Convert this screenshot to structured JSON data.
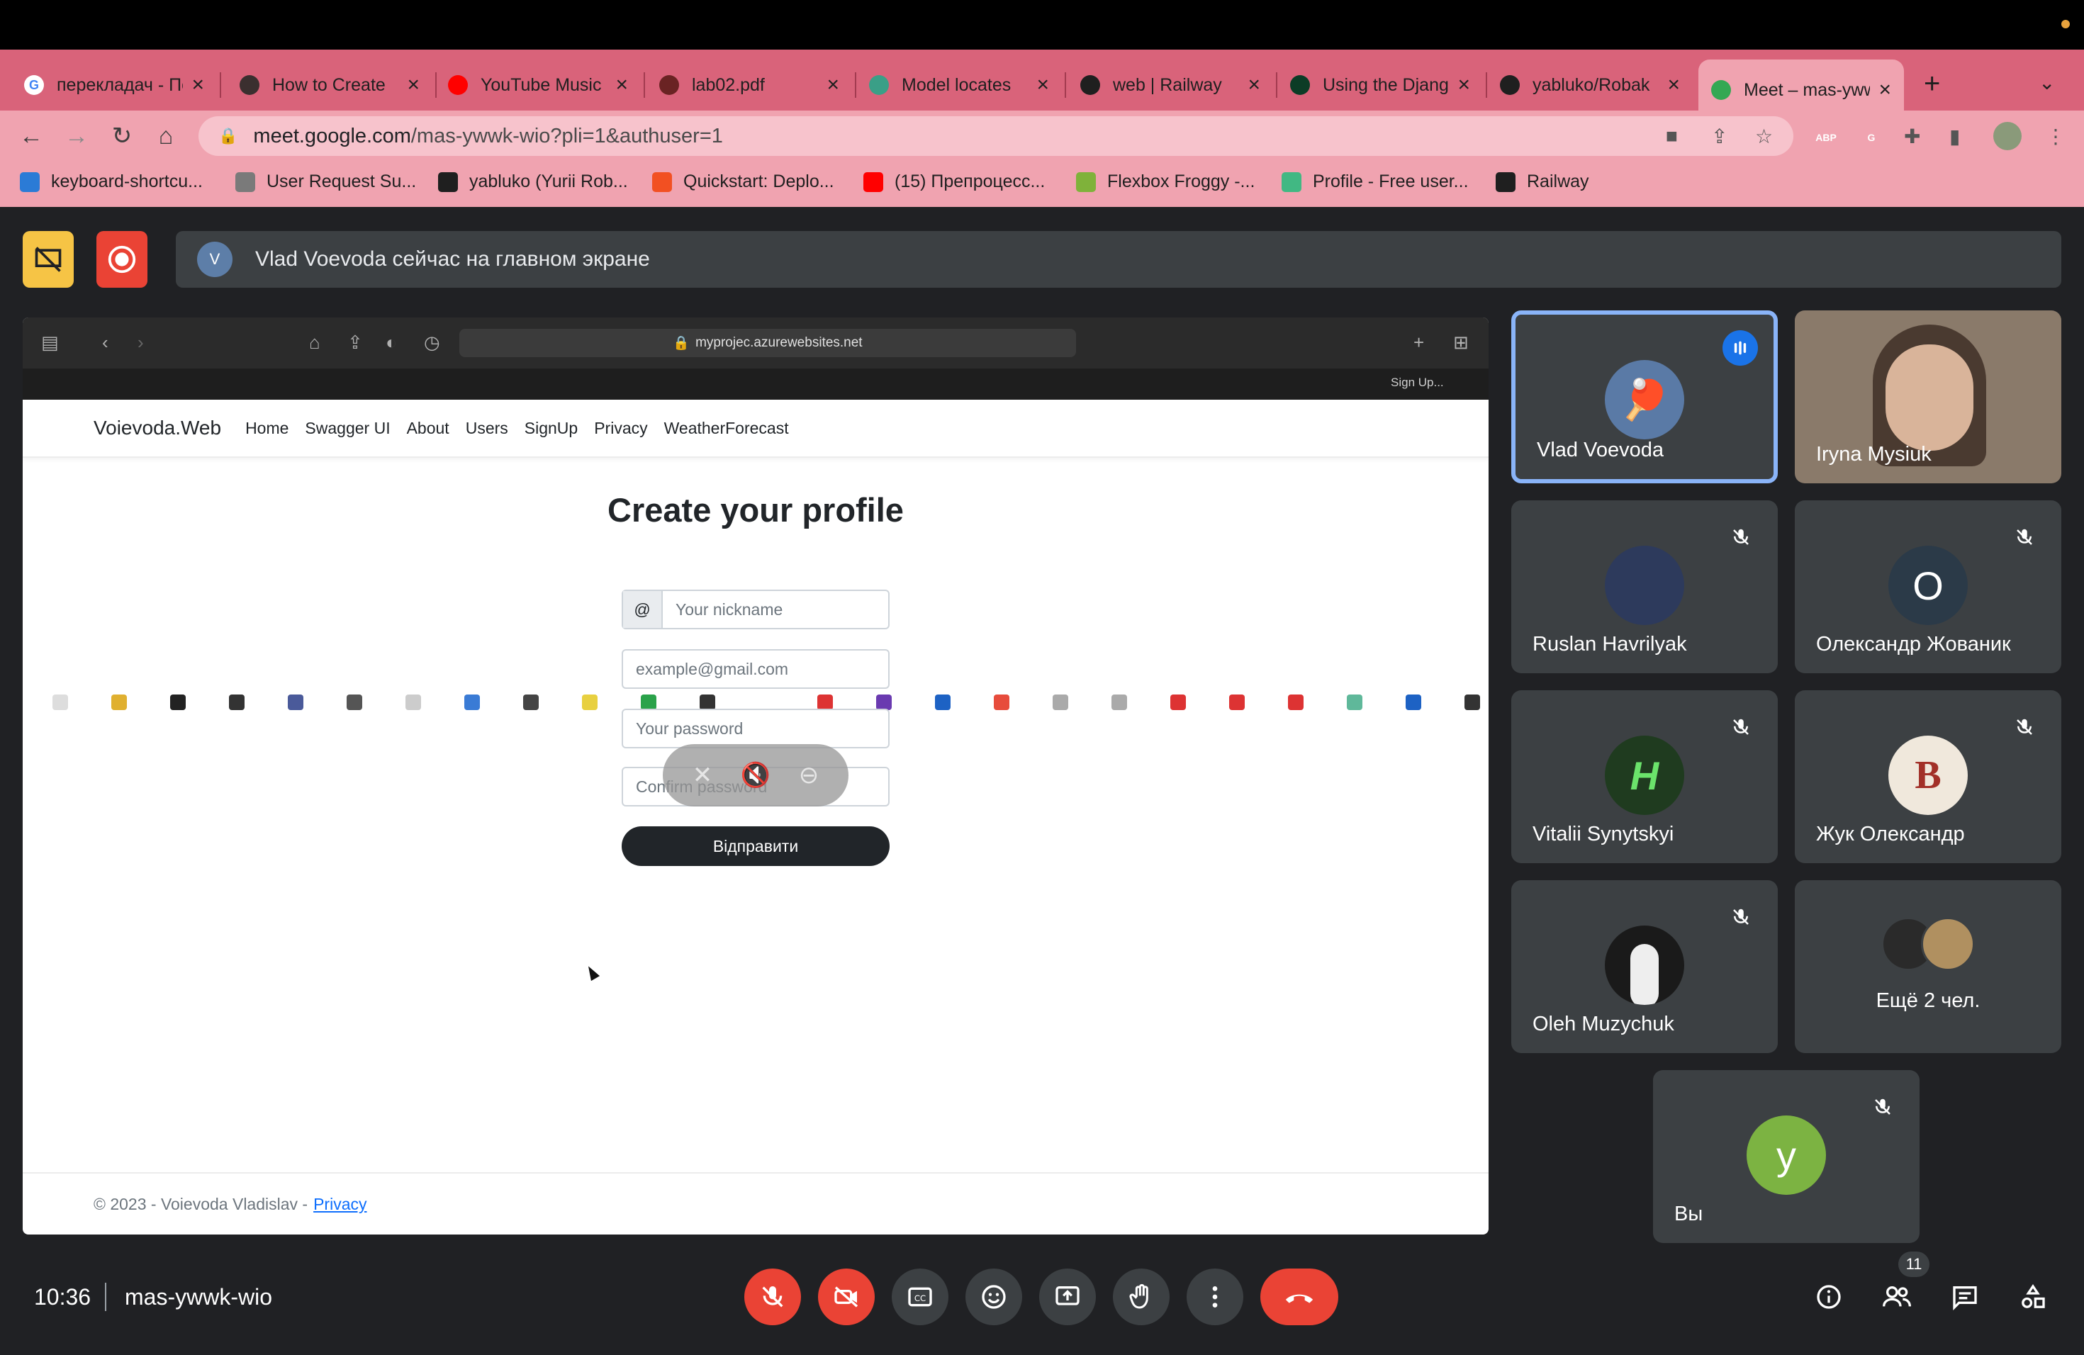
{
  "browser": {
    "tabs": [
      {
        "title": "перекладач - Пошук Google",
        "favicon": "google-icon",
        "color": "#ffffff"
      },
      {
        "title": "How to Create",
        "favicon": "avatar-icon",
        "color": "#3b2f2f"
      },
      {
        "title": "YouTube Music",
        "favicon": "youtube-music-icon",
        "color": "#ff0000"
      },
      {
        "title": "lab02.pdf",
        "favicon": "pdf-icon",
        "color": "#6a2323"
      },
      {
        "title": "Model locates",
        "favicon": "openai-icon",
        "color": "#3a9f87"
      },
      {
        "title": "web | Railway",
        "favicon": "railway-icon",
        "color": "#1f1f1f"
      },
      {
        "title": "Using the Django",
        "favicon": "django-icon",
        "color": "#0c3c26"
      },
      {
        "title": "yabluko/Robak",
        "favicon": "github-icon",
        "color": "#1f1f1f"
      },
      {
        "title": "Meet – mas-ywwk-wio",
        "favicon": "meet-icon",
        "color": "#34a853",
        "active": true
      }
    ],
    "new_tab": "+",
    "url_host": "meet.google.com",
    "url_path": "/mas-ywwk-wio?pli=1&authuser=1",
    "bookmarks": [
      {
        "label": "keyboard-shortcu...",
        "icon": "vscode-icon",
        "color": "#2b7bd6"
      },
      {
        "label": "User Request Su...",
        "icon": "openai-icon",
        "color": "#7a7a7a"
      },
      {
        "label": "yabluko (Yurii Rob...",
        "icon": "github-icon",
        "color": "#1f1f1f"
      },
      {
        "label": "Quickstart: Deplo...",
        "icon": "microsoft-icon",
        "color": "#f25022"
      },
      {
        "label": "(15) Препроцесс...",
        "icon": "youtube-icon",
        "color": "#ff0000"
      },
      {
        "label": "Flexbox Froggy -...",
        "icon": "frog-icon",
        "color": "#7fb23a"
      },
      {
        "label": "Profile - Free user...",
        "icon": "vue-icon",
        "color": "#41b883"
      },
      {
        "label": "Railway",
        "icon": "railway-icon",
        "color": "#1f1f1f"
      }
    ],
    "extensions": [
      {
        "label": "ABP",
        "color": "#8a8a8a"
      },
      {
        "label": "G",
        "color": "#4285f4"
      }
    ]
  },
  "meet": {
    "banner_text": "Vlad Voevoda сейчас на главном экране",
    "time": "10:36",
    "meeting_code": "mas-ywwk-wio",
    "participants_count": "11",
    "participants": [
      {
        "name": "Vlad Voevoda",
        "speaking": true,
        "avatar_color": "#5a7aa6"
      },
      {
        "name": "Iryna Mysiuk",
        "video": true,
        "avatar_color": "#8a7a6a"
      },
      {
        "name": "Ruslan Havrilyak",
        "muted": true,
        "avatar_color": "#2d3a5c"
      },
      {
        "name": "Олександр Жованик",
        "muted": true,
        "initial": "О",
        "avatar_color": "#2b3a48"
      },
      {
        "name": "Vitalii Synytskyi",
        "muted": true,
        "avatar_color": "#1f3b1f"
      },
      {
        "name": "Жук Олександр",
        "muted": true,
        "avatar_color": "#a23028"
      },
      {
        "name": "Oleh Muzychuk",
        "muted": true,
        "avatar_color": "#202020"
      },
      {
        "name": "Ещё 2 чел.",
        "avatar_color": "#3a3a3a"
      },
      {
        "name": "Вы",
        "muted": true,
        "initial": "у",
        "avatar_color": "#7cb342"
      }
    ]
  },
  "shared": {
    "url": "myprojec.azurewebsites.net",
    "bookmark_label": "Sign Up...",
    "site": {
      "brand": "Voievoda.Web",
      "nav": [
        "Home",
        "Swagger UI",
        "About",
        "Users",
        "SignUp",
        "Privacy",
        "WeatherForecast"
      ],
      "title": "Create your profile",
      "at_addon": "@",
      "nickname_placeholder": "Your nickname",
      "email_placeholder": "example@gmail.com",
      "password_placeholder": "Your password",
      "confirm_placeholder": "Confirm password",
      "submit_label": "Відправити",
      "footer_text": "© 2023 - Voievoda Vladislav -",
      "footer_link": "Privacy"
    }
  }
}
